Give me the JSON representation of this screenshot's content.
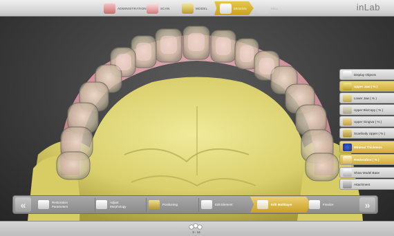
{
  "app": {
    "brand": "inLab"
  },
  "phases": [
    {
      "label": "ADMINISTRATION",
      "state": "normal"
    },
    {
      "label": "SCAN",
      "state": "normal"
    },
    {
      "label": "MODEL",
      "state": "normal"
    },
    {
      "label": "DESIGN",
      "state": "active"
    },
    {
      "label": "MILL",
      "state": "disabled"
    }
  ],
  "objects": [
    {
      "label": "Display Objects",
      "selected": false,
      "icon": "display-objects-icon"
    },
    {
      "label": "Upper Jaw  ( % )",
      "selected": true,
      "icon": "upper-jaw-icon"
    },
    {
      "label": "Lower Jaw  ( % )",
      "selected": false,
      "icon": "lower-jaw-icon"
    },
    {
      "label": "Upper BioCopy  ( % )",
      "selected": false,
      "icon": "biocopy-icon"
    },
    {
      "label": "Upper Gingiva  ( % )",
      "selected": false,
      "icon": "gingiva-icon"
    },
    {
      "label": "Scanbody Upper  ( % )",
      "selected": false,
      "icon": "scanbody-icon"
    },
    {
      "label": "Minimal Thickness",
      "selected": true,
      "icon": "minimal-thickness-icon"
    },
    {
      "label": "Restoration  ( % )",
      "selected": true,
      "icon": "restoration-icon"
    },
    {
      "label": "Show Model Base",
      "selected": false,
      "icon": "model-base-icon"
    },
    {
      "label": "Attachment",
      "selected": false,
      "icon": "attachment-icon"
    }
  ],
  "steps": [
    {
      "label": "Restoration Parameters",
      "active": false
    },
    {
      "label": "Adjust Morphology",
      "active": false
    },
    {
      "label": "Positioning",
      "active": false
    },
    {
      "label": "Edit Element",
      "active": false
    },
    {
      "label": "Edit Multilayer",
      "active": true
    },
    {
      "label": "Finalize",
      "active": false
    }
  ],
  "nav": {
    "prev": "«",
    "next": "»"
  },
  "status": {
    "tooth_range": "3 - 14"
  },
  "colors": {
    "accent": "#d4ad34",
    "model": "#e3dd85",
    "gingiva": "#e4a2ab",
    "teeth": "#d8ccb6"
  }
}
